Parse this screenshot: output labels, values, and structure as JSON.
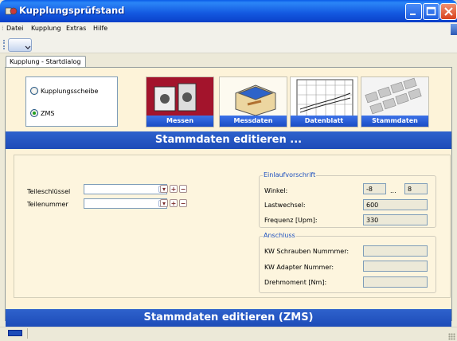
{
  "window": {
    "title": "Kupplungsprüfstand",
    "icons": {
      "app": "app-icon",
      "minimize": "minimize-icon",
      "maximize": "maximize-icon",
      "close": "close-icon"
    }
  },
  "menu": {
    "items": [
      "Datei",
      "Kupplung",
      "Extras",
      "Hilfe"
    ]
  },
  "tabs": [
    {
      "label": "Kupplung - Startdialog",
      "active": true
    }
  ],
  "mode_select": {
    "options": [
      {
        "label": "Kupplungsscheibe",
        "selected": false
      },
      {
        "label": "ZMS",
        "selected": true
      }
    ]
  },
  "nav_buttons": [
    {
      "label": "Messen",
      "icon": "measuring-device-icon"
    },
    {
      "label": "Messdaten",
      "icon": "data-box-icon"
    },
    {
      "label": "Datenblatt",
      "icon": "datasheet-chart-icon"
    },
    {
      "label": "Stammdaten",
      "icon": "keyboard-icon"
    }
  ],
  "banner_top": "Stammdaten editieren ...",
  "banner_bottom": "Stammdaten editieren (ZMS)",
  "form": {
    "teileschluessel_label": "Teileschlüssel",
    "teilenummer_label": "Teilenummer",
    "teileschluessel_value": "",
    "teilenummer_value": "",
    "einlauf": {
      "title": "Einlaufvorschrift",
      "winkel_label": "Winkel:",
      "winkel_from": "-8",
      "winkel_sep": "...",
      "winkel_to": "8",
      "lastwechsel_label": "Lastwechsel:",
      "lastwechsel_value": "600",
      "frequenz_label": "Frequenz [Upm]:",
      "frequenz_value": "330"
    },
    "anschluss": {
      "title": "Anschluss",
      "kw_schrauben_label": "KW Schrauben Nummmer:",
      "kw_schrauben_value": "",
      "kw_adapter_label": "KW Adapter Nummer:",
      "kw_adapter_value": "",
      "drehmoment_label": "Drehmoment [Nm]:",
      "drehmoment_value": ""
    }
  },
  "colors": {
    "accent": "#1d4cb8",
    "panel": "#fdf5de",
    "selected_radio": "#21a121"
  }
}
